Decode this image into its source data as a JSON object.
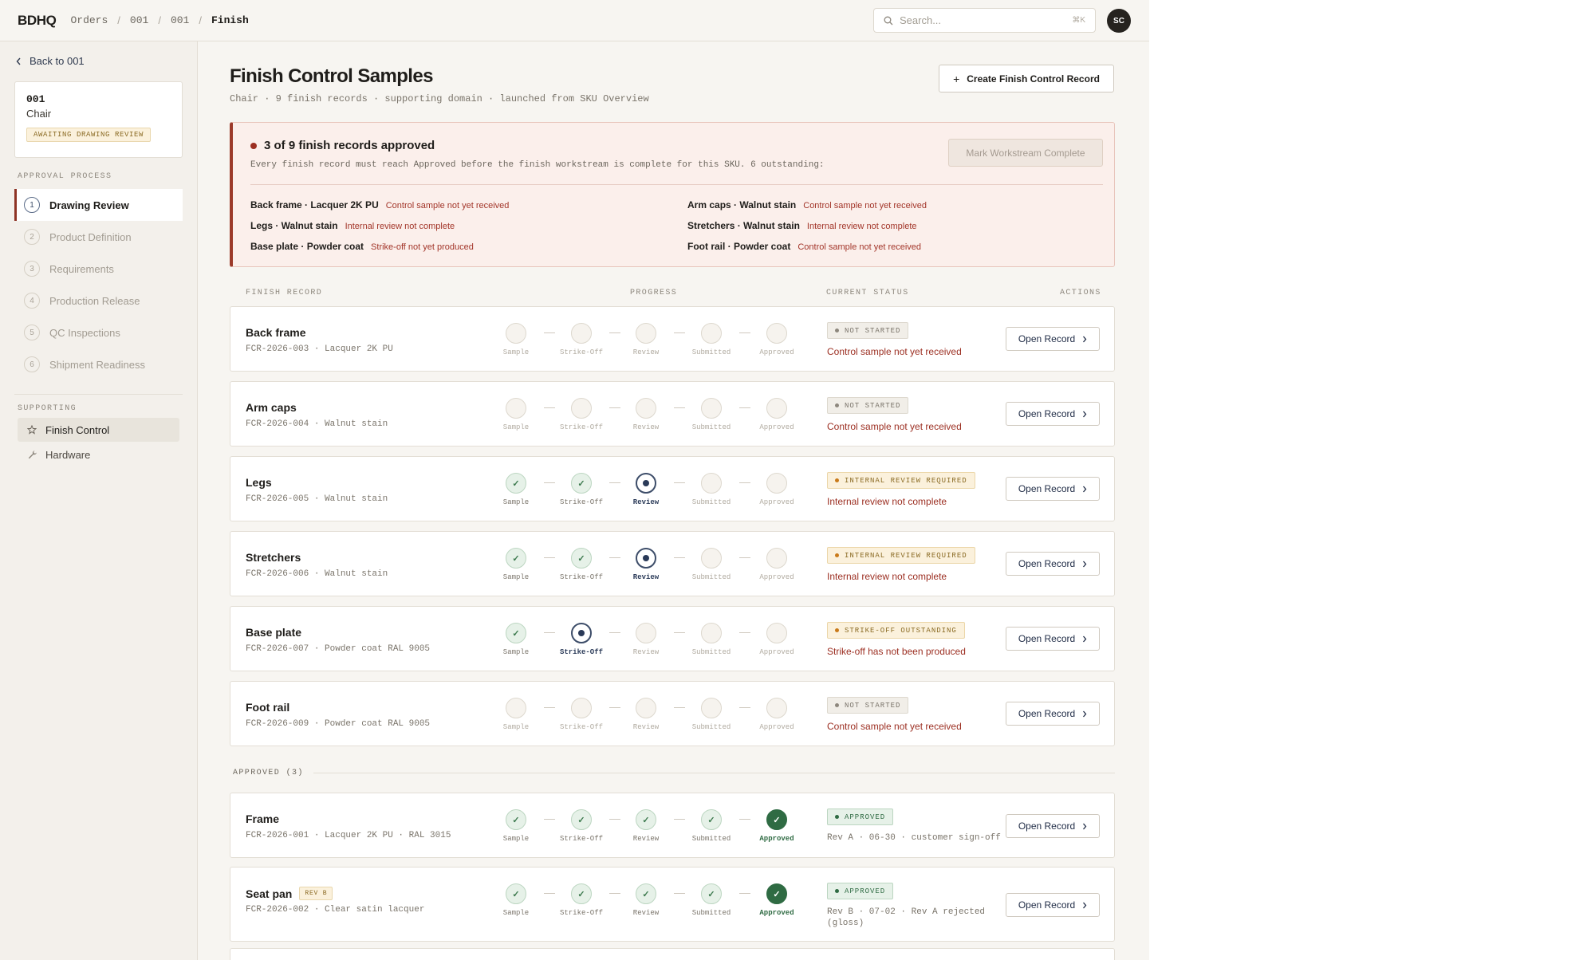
{
  "topbar": {
    "brand": "BDHQ",
    "breadcrumbs": [
      "Orders",
      "001",
      "001",
      "Finish"
    ],
    "search_placeholder": "Search...",
    "search_shortcut": "⌘K",
    "avatar_initials": "SC"
  },
  "sidebar": {
    "back_label": "Back to 001",
    "sku": {
      "code": "001",
      "name": "Chair",
      "badge": "AWAITING DRAWING REVIEW"
    },
    "approval_heading": "APPROVAL PROCESS",
    "steps": [
      {
        "num": "1",
        "label": "Drawing Review"
      },
      {
        "num": "2",
        "label": "Product Definition"
      },
      {
        "num": "3",
        "label": "Requirements"
      },
      {
        "num": "4",
        "label": "Production Release"
      },
      {
        "num": "5",
        "label": "QC Inspections"
      },
      {
        "num": "6",
        "label": "Shipment Readiness"
      }
    ],
    "supporting_heading": "SUPPORTING",
    "supporting": [
      {
        "label": "Finish Control",
        "icon": "star-icon"
      },
      {
        "label": "Hardware",
        "icon": "wrench-icon"
      }
    ]
  },
  "page": {
    "title": "Finish Control Samples",
    "subtitle": "Chair · 9 finish records · supporting domain · launched from SKU Overview",
    "create_button": "Create Finish Control Record"
  },
  "alert": {
    "title": "3 of 9 finish records approved",
    "description": "Every finish record must reach Approved before the finish workstream is complete for this SKU. 6 outstanding:",
    "button": "Mark Workstream Complete",
    "outstanding": [
      {
        "item": "Back frame · Lacquer 2K PU",
        "reason": "Control sample not yet received"
      },
      {
        "item": "Arm caps · Walnut stain",
        "reason": "Control sample not yet received"
      },
      {
        "item": "Legs · Walnut stain",
        "reason": "Internal review not complete"
      },
      {
        "item": "Stretchers · Walnut stain",
        "reason": "Internal review not complete"
      },
      {
        "item": "Base plate · Powder coat",
        "reason": "Strike-off not yet produced"
      },
      {
        "item": "Foot rail · Powder coat",
        "reason": "Control sample not yet received"
      }
    ]
  },
  "table": {
    "headers": {
      "record": "FINISH RECORD",
      "progress": "PROGRESS",
      "status": "CURRENT STATUS",
      "actions": "ACTIONS"
    },
    "stage_labels": [
      "Sample",
      "Strike-Off",
      "Review",
      "Submitted",
      "Approved"
    ],
    "open_label": "Open Record",
    "approved_heading": "APPROVED (3)",
    "rows": [
      {
        "name": "Back frame",
        "code": "FCR-2026-003 · Lacquer 2K PU",
        "done": 0,
        "current": -1,
        "pill": "NOT STARTED",
        "pill_kind": "ns",
        "note": "Control sample not yet received"
      },
      {
        "name": "Arm caps",
        "code": "FCR-2026-004 · Walnut stain",
        "done": 0,
        "current": -1,
        "pill": "NOT STARTED",
        "pill_kind": "ns",
        "note": "Control sample not yet received"
      },
      {
        "name": "Legs",
        "code": "FCR-2026-005 · Walnut stain",
        "done": 2,
        "current": 2,
        "pill": "INTERNAL REVIEW REQUIRED",
        "pill_kind": "ir",
        "note": "Internal review not complete"
      },
      {
        "name": "Stretchers",
        "code": "FCR-2026-006 · Walnut stain",
        "done": 2,
        "current": 2,
        "pill": "INTERNAL REVIEW REQUIRED",
        "pill_kind": "ir",
        "note": "Internal review not complete"
      },
      {
        "name": "Base plate",
        "code": "FCR-2026-007 · Powder coat RAL 9005",
        "done": 1,
        "current": 1,
        "pill": "STRIKE-OFF OUTSTANDING",
        "pill_kind": "ir",
        "note": "Strike-off has not been produced"
      },
      {
        "name": "Foot rail",
        "code": "FCR-2026-009 · Powder coat RAL 9005",
        "done": 0,
        "current": -1,
        "pill": "NOT STARTED",
        "pill_kind": "ns",
        "note": "Control sample not yet received"
      }
    ],
    "approved_rows": [
      {
        "name": "Frame",
        "rev": "",
        "code": "FCR-2026-001 · Lacquer 2K PU · RAL 3015",
        "pill": "APPROVED",
        "note": "Rev A · 06-30 · customer sign-off"
      },
      {
        "name": "Seat pan",
        "rev": "REV B",
        "code": "FCR-2026-002 · Clear satin lacquer",
        "pill": "APPROVED",
        "note": "Rev B · 07-02 · Rev A rejected (gloss)"
      }
    ]
  },
  "colors": {
    "accent": "#8e3325",
    "approved": "#2f6b43",
    "current": "#2a3a58"
  }
}
